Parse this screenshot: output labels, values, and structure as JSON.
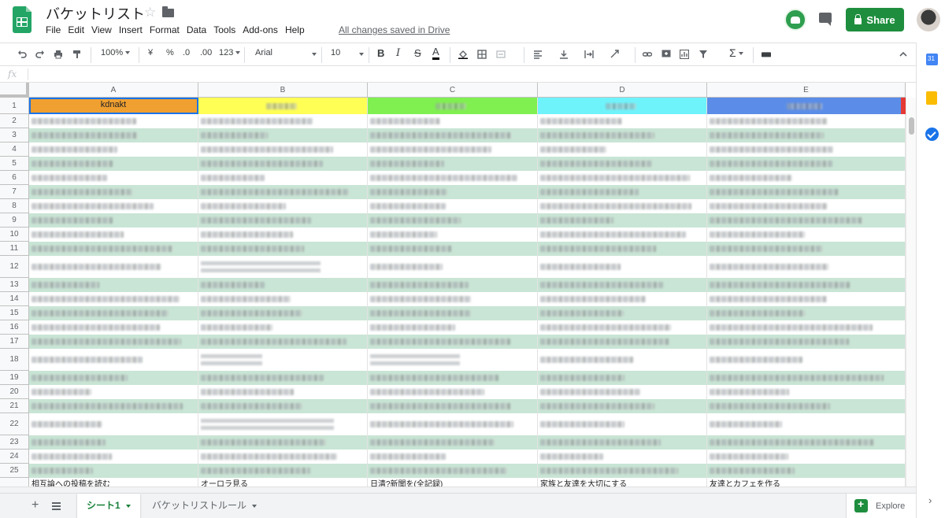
{
  "app": {
    "title": "バケットリスト",
    "saved_status": "All changes saved in Drive",
    "share_label": "Share"
  },
  "menu": [
    "File",
    "Edit",
    "View",
    "Insert",
    "Format",
    "Data",
    "Tools",
    "Add-ons",
    "Help"
  ],
  "toolbar": {
    "zoom": "100%",
    "currency": "¥",
    "percent": "%",
    "decimal_decrease": ".0",
    "decimal_increase": ".00",
    "number_format": "123",
    "font": "Arial",
    "font_size": "10",
    "bold": "B",
    "italic": "I",
    "strike": "S",
    "text_color": "A",
    "sum": "Σ"
  },
  "formula_bar": {
    "label": "fx",
    "value": ""
  },
  "columns": [
    "A",
    "B",
    "C",
    "D",
    "E"
  ],
  "header_row": {
    "number": "1",
    "cells": [
      "kdnakt",
      "",
      "",
      "",
      ""
    ],
    "colors": [
      "#f0a030",
      "#ffff55",
      "#7ff050",
      "#6ff3fb",
      "#5b8de8"
    ]
  },
  "row_numbers": [
    "2",
    "3",
    "4",
    "5",
    "6",
    "7",
    "8",
    "9",
    "10",
    "11",
    "12",
    "13",
    "14",
    "15",
    "16",
    "17",
    "18",
    "19",
    "20",
    "21",
    "22",
    "23",
    "24",
    "25"
  ],
  "partial_row": [
    "相互論への投稿を読む",
    "オーロラ見る",
    "日清?新聞を(全記録)",
    "家族と友達を大切にする",
    "友達とカフェを作る"
  ],
  "band_color": "#c9e5d5",
  "sheets": [
    {
      "label": "シート1",
      "active": true
    },
    {
      "label": "バケットリストルール",
      "active": false
    }
  ],
  "explore_label": "Explore"
}
